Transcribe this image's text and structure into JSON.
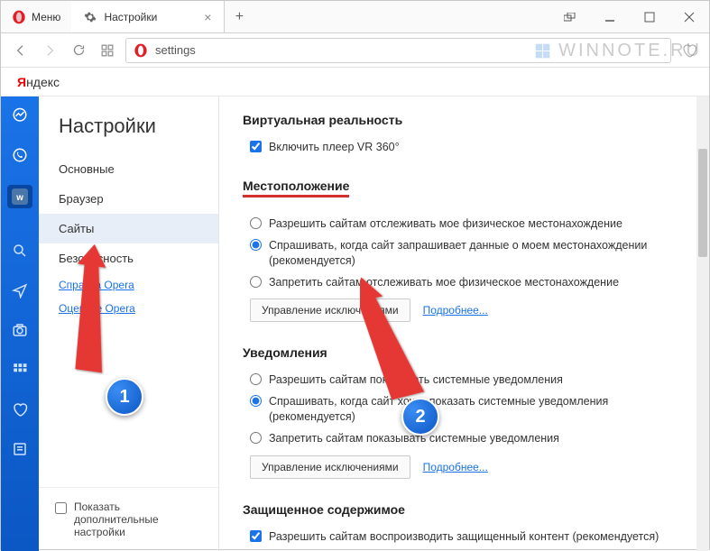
{
  "titlebar": {
    "menu": "Меню",
    "tab_title": "Настройки"
  },
  "address": "settings",
  "yandex": {
    "y": "Я",
    "rest": "ндекс"
  },
  "watermark": "WINNOTE.RU",
  "sidebar": {
    "heading": "Настройки",
    "items": [
      "Основные",
      "Браузер",
      "Сайты",
      "Безопасность"
    ],
    "selected_index": 2,
    "links": [
      "Справка Opera",
      "Оцените Opera"
    ],
    "advanced_label": "Показать дополнительные настройки"
  },
  "content": {
    "vr": {
      "title": "Виртуальная реальность",
      "checkbox": "Включить плеер VR 360°",
      "checked": true
    },
    "location": {
      "title": "Местоположение",
      "radios": [
        "Разрешить сайтам отслеживать мое физическое местонахождение",
        "Спрашивать, когда сайт запрашивает данные о моем местонахождении (рекомендуется)",
        "Запретить сайтам отслеживать мое физическое местонахождение"
      ],
      "selected": 1,
      "manage": "Управление исключениями",
      "more": "Подробнее..."
    },
    "notifications": {
      "title": "Уведомления",
      "radios": [
        "Разрешить сайтам показывать системные уведомления",
        "Спрашивать, когда сайт хочет показать системные уведомления (рекомендуется)",
        "Запретить сайтам показывать системные уведомления"
      ],
      "selected": 1,
      "manage": "Управление исключениями",
      "more": "Подробнее..."
    },
    "protected": {
      "title": "Защищенное содержимое",
      "checkbox": "Разрешить сайтам воспроизводить защищенный контент (рекомендуется)",
      "checked": true
    }
  },
  "annotations": {
    "badge1": "1",
    "badge2": "2"
  }
}
